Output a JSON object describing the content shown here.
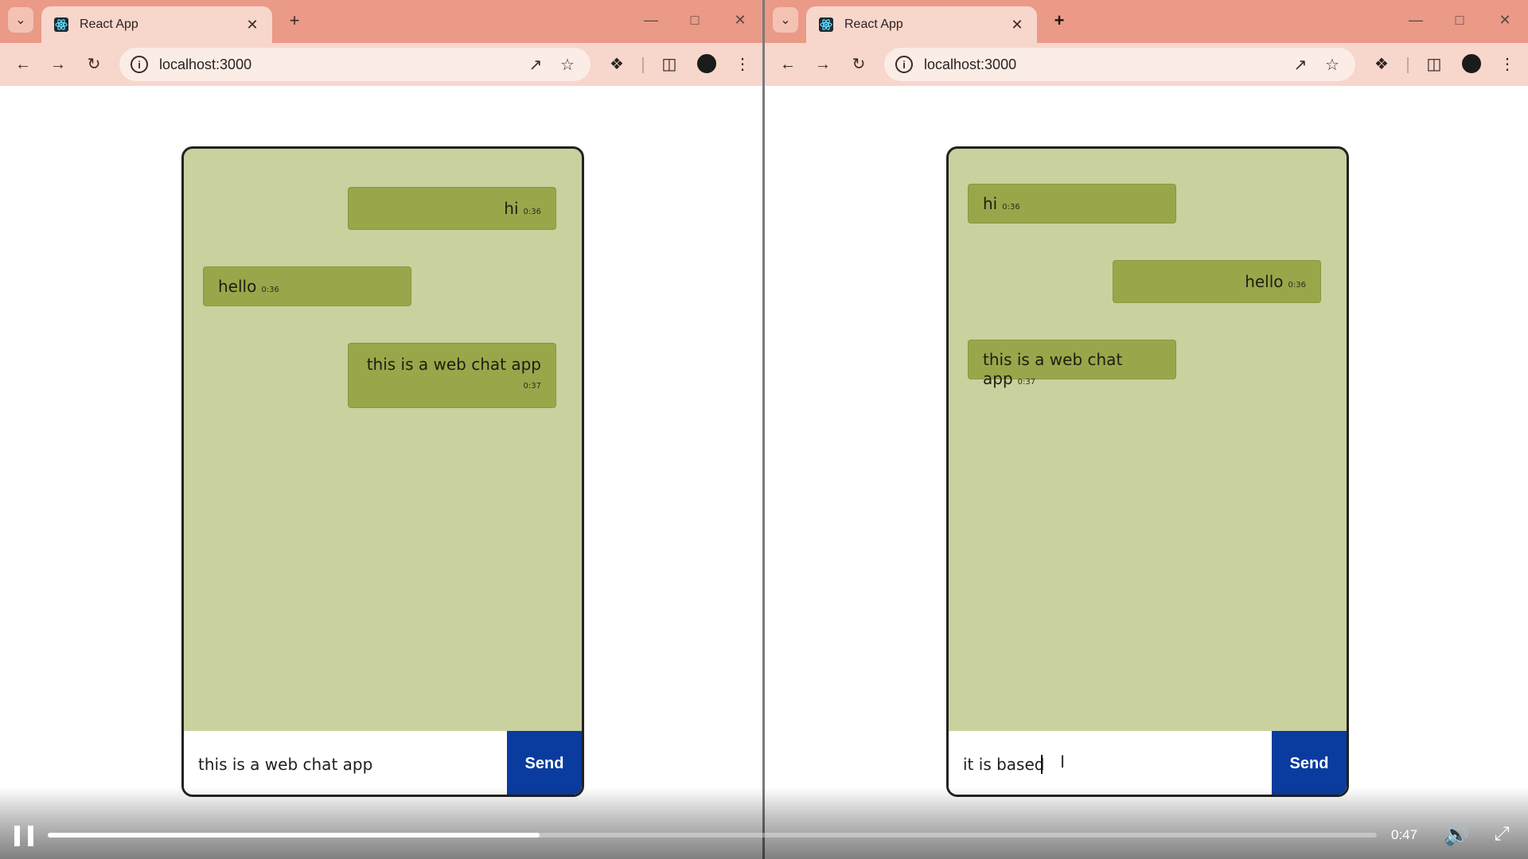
{
  "left_window": {
    "tab_title": "React App",
    "url": "localhost:3000",
    "messages": [
      {
        "text": "hi",
        "time": "0:36",
        "align": "right"
      },
      {
        "text": "hello",
        "time": "0:36",
        "align": "left"
      },
      {
        "text": "this is a web chat app",
        "time": "0:37",
        "align": "right"
      }
    ],
    "input_value": "this is a web chat app",
    "send_label": "Send"
  },
  "right_window": {
    "tab_title": "React App",
    "url": "localhost:3000",
    "messages": [
      {
        "text": "hi",
        "time": "0:36",
        "align": "left"
      },
      {
        "text": "hello",
        "time": "0:36",
        "align": "right"
      },
      {
        "text": "this is a web chat app",
        "time": "0:37",
        "align": "left"
      }
    ],
    "input_value": "it is based",
    "send_label": "Send"
  },
  "player": {
    "time": "0:47",
    "progress_fraction": 0.37
  },
  "icons": {
    "tab_search": "chevron-down-icon",
    "favicon": "react-icon",
    "tab_close": "close-icon",
    "new_tab": "plus-icon",
    "back": "back-arrow-icon",
    "forward": "forward-arrow-icon",
    "reload": "reload-icon",
    "site_info": "info-icon",
    "open_external": "open-external-icon",
    "bookmark": "star-icon",
    "extensions": "puzzle-icon",
    "side_panel": "side-panel-icon",
    "menu": "kebab-menu-icon",
    "pause": "pause-icon",
    "volume": "volume-icon",
    "fullscreen_exit": "exit-fullscreen-icon"
  },
  "colors": {
    "tabstrip": "#ea9a87",
    "toolbar": "#f7d6cc",
    "chat_background": "#c9d19e",
    "bubble": "#9aa64a",
    "send_button": "#0a3c9f"
  }
}
